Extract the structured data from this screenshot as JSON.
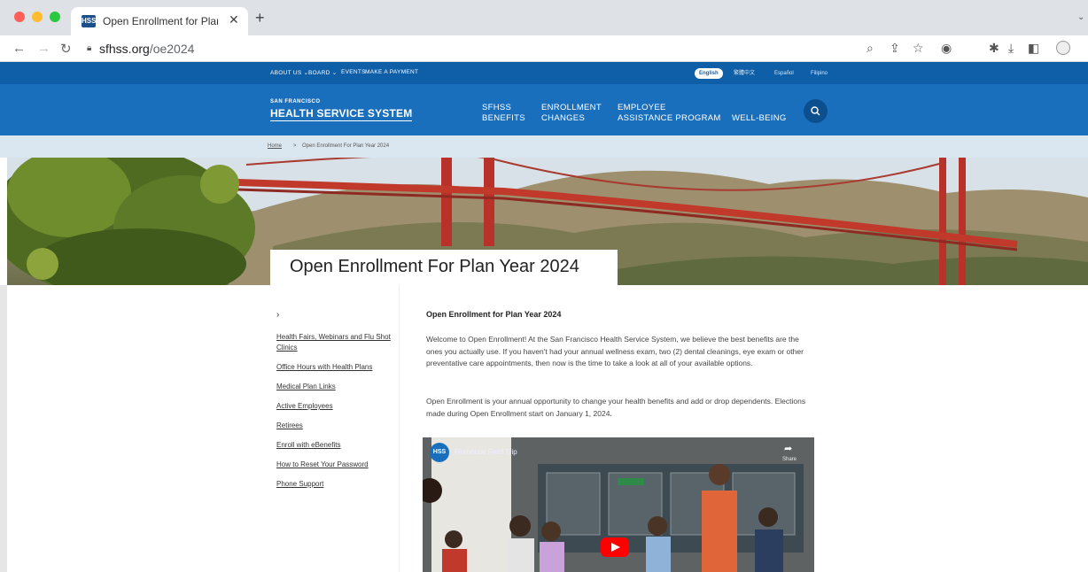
{
  "browser": {
    "tab_title": "Open Enrollment for Plan Year",
    "favicon_text": "HSS",
    "url_domain": "sfhss.org",
    "url_path": "/oe2024"
  },
  "utility_nav": {
    "items": [
      "ABOUT US ⌄",
      "BOARD ⌄",
      "EVENTS",
      "MAKE A PAYMENT"
    ],
    "languages": [
      "English",
      "繁體中文",
      "Español",
      "Filipino"
    ]
  },
  "header": {
    "logo_small": "SAN FRANCISCO",
    "logo_large": "HEALTH SERVICE SYSTEM",
    "nav": [
      {
        "line1": "SFHSS",
        "line2": "BENEFITS"
      },
      {
        "line1": "ENROLLMENT",
        "line2": "CHANGES"
      },
      {
        "line1": "EMPLOYEE",
        "line2": "ASSISTANCE PROGRAM"
      },
      {
        "line1": "WELL-BEING",
        "line2": ""
      }
    ]
  },
  "breadcrumb": {
    "home": "Home",
    "separator": ">",
    "current": "Open Enrollment For Plan Year 2024"
  },
  "hero": {
    "title": "Open Enrollment For Plan Year 2024"
  },
  "sidebar": {
    "arrow": "›",
    "links": [
      "Health Fairs, Webinars and Flu Shot Clinics",
      "Office Hours with Health Plans",
      "Medical Plan Links",
      "Active Employees",
      "Retirees",
      "Enroll with eBenefits",
      "How to Reset Your Password",
      "Phone Support"
    ]
  },
  "content": {
    "heading": "Open Enrollment for Plan Year 2024",
    "paragraph1": "Welcome to Open Enrollment! At the San Francisco Health Service System, we believe the best benefits are the ones you actually use. If you haven't had your annual wellness exam, two (2) dental cleanings, eye exam or other preventative care appointments, then now is the time to take a look at all of your available options.",
    "paragraph2": "Open Enrollment is your annual opportunity to change your health benefits and add or drop dependents. Elections made during Open Enrollment start on January 1, 2024."
  },
  "video": {
    "channel_logo": "HSS",
    "title": "Firehouse Field Trip",
    "share_label": "Share"
  },
  "colors": {
    "utility_bar": "#0f5fa8",
    "header": "#1a6fbd",
    "breadcrumb_bar": "#dbe7f0",
    "bridge": "#c0392b"
  }
}
